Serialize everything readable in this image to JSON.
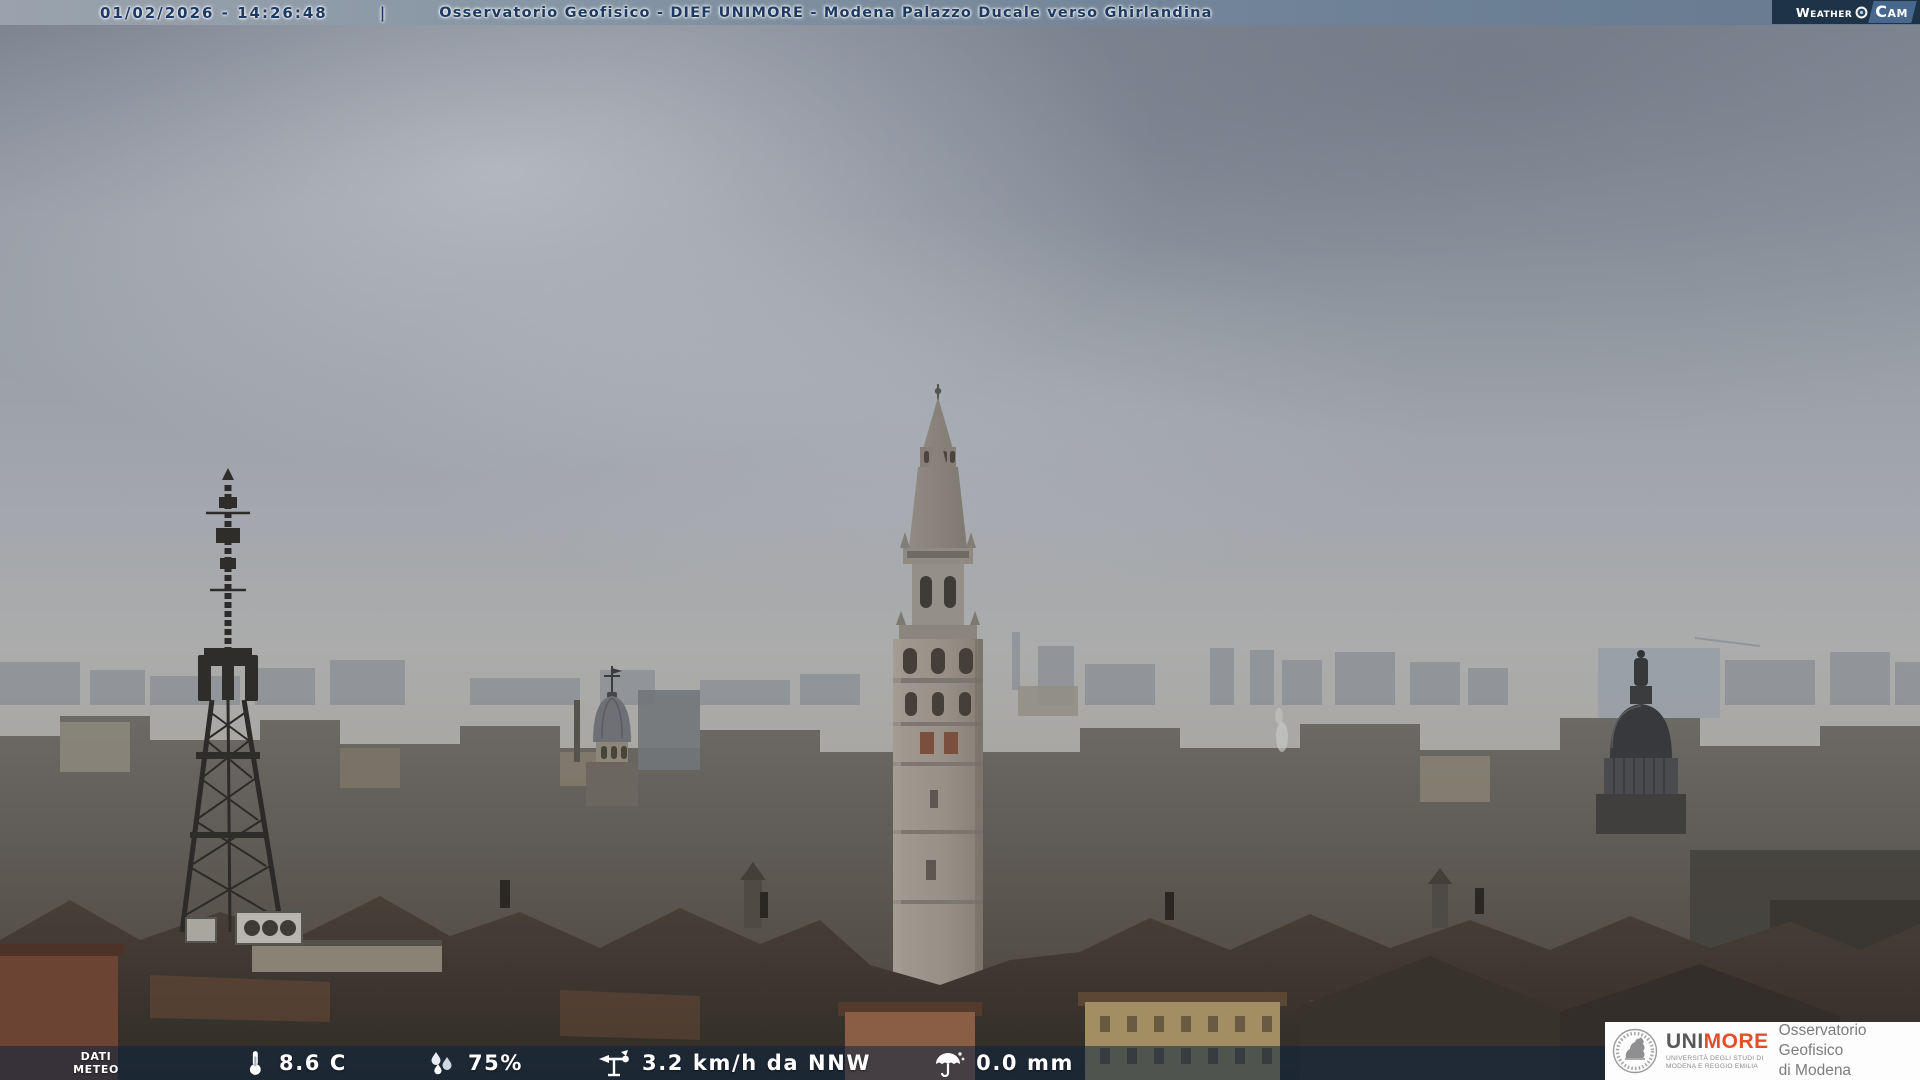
{
  "header": {
    "timestamp": "01/02/2026 - 14:26:48",
    "separator": "|",
    "title": "Osservatorio Geofisico - DIEF UNIMORE - Modena Palazzo Ducale verso Ghirlandina"
  },
  "weathercam": {
    "weather": "Weather",
    "cam": "Cam"
  },
  "meteo": {
    "label_line1": "DATI",
    "label_line2": "METEO",
    "metrics": [
      {
        "icon": "thermometer-icon",
        "value": "8.6 C"
      },
      {
        "icon": "humidity-icon",
        "value": "75%"
      },
      {
        "icon": "wind-vane-icon",
        "value": "3.2 km/h da NNW"
      },
      {
        "icon": "rain-umbrella-icon",
        "value": "0.0 mm"
      }
    ]
  },
  "brand": {
    "uni": "UNI",
    "more": "MORE",
    "university_line1": "UNIVERSITÀ DEGLI STUDI DI",
    "university_line2": "MODENA E REGGIO EMILIA",
    "observatory_line1": "Osservatorio Geofisico",
    "observatory_line2": "di Modena"
  },
  "scene": {
    "landmarks": [
      "ghirlandina-tower",
      "telecom-lattice-tower",
      "chiesa-del-voto-dome",
      "san-domenico-dome",
      "modena-rooftops"
    ],
    "colors": {
      "sky_top": "#848b97",
      "sky_horizon": "#abacab",
      "far_buildings": "#7b818a",
      "mid_buildings": "#6e6c67",
      "roofs_dark": "#3a352f",
      "roof_warm": "#a28e63",
      "osd_text": "#1d3a63",
      "overlay_navy": "#0d2440",
      "wxcam_bg": "#1e3248",
      "accent_red": "#e0512a"
    }
  }
}
